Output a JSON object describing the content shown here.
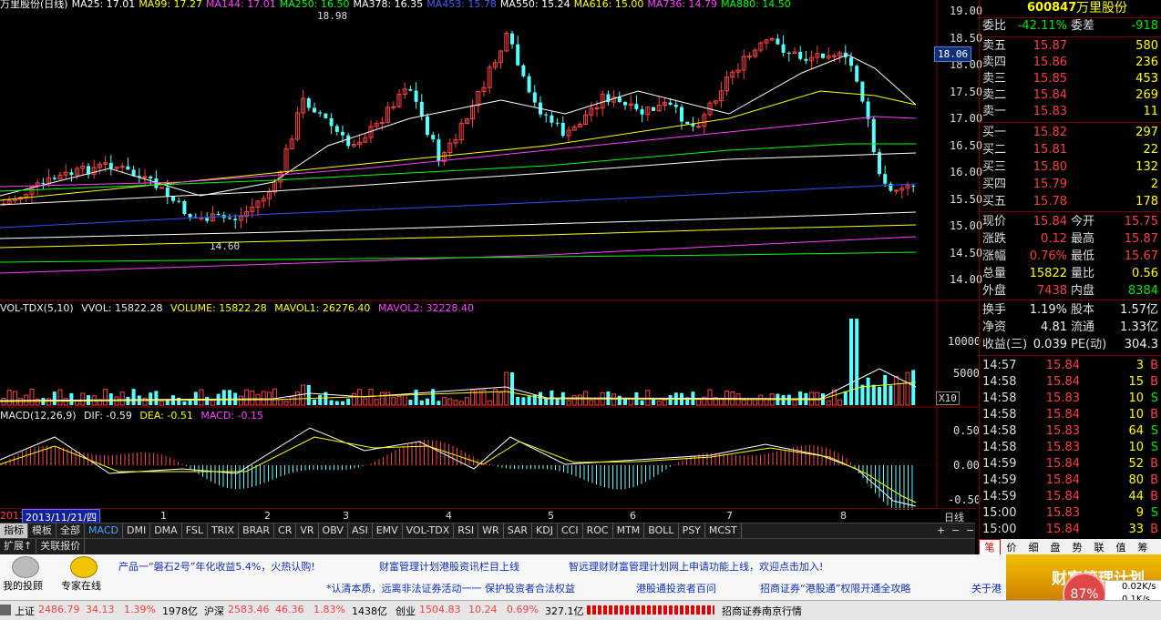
{
  "ma_legend": [
    {
      "text": "万里股份(日线)",
      "color": "#ffffff"
    },
    {
      "text": "MA25: 17.01",
      "color": "#ffffff"
    },
    {
      "text": "MA99: 17.27",
      "color": "#ffff00"
    },
    {
      "text": "MA144: 17.01",
      "color": "#ff40ff"
    },
    {
      "text": "MA250: 16.50",
      "color": "#00ff00"
    },
    {
      "text": "MA378: 16.35",
      "color": "#ffffff"
    },
    {
      "text": "MA453: 15.78",
      "color": "#4060ff"
    },
    {
      "text": "MA550: 15.24",
      "color": "#ffffff"
    },
    {
      "text": "MA616: 15.00",
      "color": "#ffff00"
    },
    {
      "text": "MA736: 14.79",
      "color": "#ff40ff"
    },
    {
      "text": "MA880: 14.50",
      "color": "#00ff00"
    }
  ],
  "price_axis": [
    "19.00",
    "18.50",
    "18.00",
    "17.50",
    "17.00",
    "16.50",
    "16.00",
    "15.50",
    "15.00",
    "14.50",
    "14.00"
  ],
  "price_tag": "18.06",
  "peak_label": "18.98",
  "low_label": "14.60",
  "vol_legend": {
    "name": "VOL-TDX(5,10)",
    "vvol": "VVOL: 15822.28",
    "volume": "VOLUME: 15822.28",
    "mavol1": "MAVOL1: 26276.40",
    "mavol2": "MAVOL2: 32228.40"
  },
  "vol_axis": [
    "10000",
    "5000"
  ],
  "vol_unit": "X10",
  "macd_legend": {
    "name": "MACD(12,26,9)",
    "dif": "DIF: -0.59",
    "dea": "DEA: -0.51",
    "macd": "MACD: -0.15"
  },
  "macd_axis": [
    "0.50",
    "0.00",
    "-0.50"
  ],
  "date_bar": {
    "year": "2013",
    "cursor_date": "2013/11/21/四",
    "months": [
      "1",
      "2",
      "3",
      "4",
      "5",
      "6",
      "7",
      "8"
    ],
    "period": "日线"
  },
  "indicator_tabs": [
    "指标",
    "模板",
    "全部",
    "MACD",
    "DMI",
    "DMA",
    "FSL",
    "TRIX",
    "BRAR",
    "CR",
    "VR",
    "OBV",
    "ASI",
    "EMV",
    "VOL-TDX",
    "RSI",
    "WR",
    "SAR",
    "KDJ",
    "CCI",
    "ROC",
    "MTM",
    "BOLL",
    "PSY",
    "MCST"
  ],
  "tab_buttons": [
    "+",
    "−",
    "−"
  ],
  "sub_tabs": [
    "扩展↑",
    "关联报价"
  ],
  "quote": {
    "code": "600847",
    "name": "万里股份",
    "webi_label": "委比",
    "webi": "-42.11%",
    "weicha_label": "委差",
    "weicha": "-918",
    "asks": [
      {
        "label": "卖五",
        "price": "15.87",
        "vol": "580"
      },
      {
        "label": "卖四",
        "price": "15.86",
        "vol": "236"
      },
      {
        "label": "卖三",
        "price": "15.85",
        "vol": "453"
      },
      {
        "label": "卖二",
        "price": "15.84",
        "vol": "269"
      },
      {
        "label": "卖一",
        "price": "15.83",
        "vol": "11"
      }
    ],
    "bids": [
      {
        "label": "买一",
        "price": "15.82",
        "vol": "297"
      },
      {
        "label": "买二",
        "price": "15.81",
        "vol": "22"
      },
      {
        "label": "买三",
        "price": "15.80",
        "vol": "132"
      },
      {
        "label": "买四",
        "price": "15.79",
        "vol": "2"
      },
      {
        "label": "买五",
        "price": "15.78",
        "vol": "178"
      }
    ],
    "stats": [
      {
        "l1": "现价",
        "v1": "15.84",
        "c1": "red",
        "l2": "今开",
        "v2": "15.75",
        "c2": "red"
      },
      {
        "l1": "涨跌",
        "v1": "0.12",
        "c1": "red",
        "l2": "最高",
        "v2": "15.87",
        "c2": "red"
      },
      {
        "l1": "涨幅",
        "v1": "0.76%",
        "c1": "red",
        "l2": "最低",
        "v2": "15.67",
        "c2": "red"
      },
      {
        "l1": "总量",
        "v1": "15822",
        "c1": "yellow",
        "l2": "量比",
        "v2": "0.56",
        "c2": "yellow"
      },
      {
        "l1": "外盘",
        "v1": "7438",
        "c1": "red",
        "l2": "内盘",
        "v2": "8384",
        "c2": "green"
      }
    ],
    "fund": [
      {
        "l1": "换手",
        "v1": "1.19%",
        "l2": "股本",
        "v2": "1.57亿"
      },
      {
        "l1": "净资",
        "v1": "4.81",
        "l2": "流通",
        "v2": "1.33亿"
      },
      {
        "l1": "收益(三)",
        "v1": "0.039",
        "l2": "PE(动)",
        "v2": "304.3"
      }
    ],
    "ticks": [
      {
        "t": "14:57",
        "p": "15.84",
        "v": "3",
        "s": "B"
      },
      {
        "t": "14:58",
        "p": "15.84",
        "v": "15",
        "s": "B"
      },
      {
        "t": "14:58",
        "p": "15.83",
        "v": "10",
        "s": "S"
      },
      {
        "t": "14:58",
        "p": "15.84",
        "v": "10",
        "s": "B"
      },
      {
        "t": "14:58",
        "p": "15.83",
        "v": "64",
        "s": "S"
      },
      {
        "t": "14:58",
        "p": "15.83",
        "v": "10",
        "s": "S"
      },
      {
        "t": "14:59",
        "p": "15.84",
        "v": "52",
        "s": "B"
      },
      {
        "t": "14:59",
        "p": "15.84",
        "v": "80",
        "s": "B"
      },
      {
        "t": "14:59",
        "p": "15.84",
        "v": "44",
        "s": "B"
      },
      {
        "t": "15:00",
        "p": "15.83",
        "v": "9",
        "s": "S"
      },
      {
        "t": "15:00",
        "p": "15.84",
        "v": "33",
        "s": "B"
      }
    ]
  },
  "bottom_tabs": [
    "笔",
    "价",
    "细",
    "盘",
    "势",
    "联",
    "值",
    "筹"
  ],
  "news": {
    "btn1": "我的投顾",
    "btn2": "专家在线",
    "row1": [
      "产品一“磐石2号”年化收益5.4%，火热认购!",
      "财富管理计划港股资讯栏目上线",
      "智远理财财富管理计划网上申请功能上线，欢迎点击加入!"
    ],
    "row2": [
      "*认清本质，远离非法证券活动一一 保护投资者合法权益",
      "港股通投资者百问",
      "招商证券“港股通”权限开通全攻略",
      "关于港"
    ],
    "ad": "财富管理计划",
    "percent": "87%",
    "speed_up": "0.02K/s",
    "speed_down": "0.1K/s"
  },
  "status": [
    {
      "label": "上证",
      "value": "2486.79",
      "change": "34.13",
      "pct": "1.39%",
      "amount": "1978亿"
    },
    {
      "label": "沪深",
      "value": "2583.46",
      "change": "46.36",
      "pct": "1.83%",
      "amount": "1438亿"
    },
    {
      "label": "创业",
      "value": "1504.83",
      "change": "10.24",
      "pct": "0.69%",
      "amount": "327.1亿"
    }
  ],
  "broker": "招商证券南京行情"
}
